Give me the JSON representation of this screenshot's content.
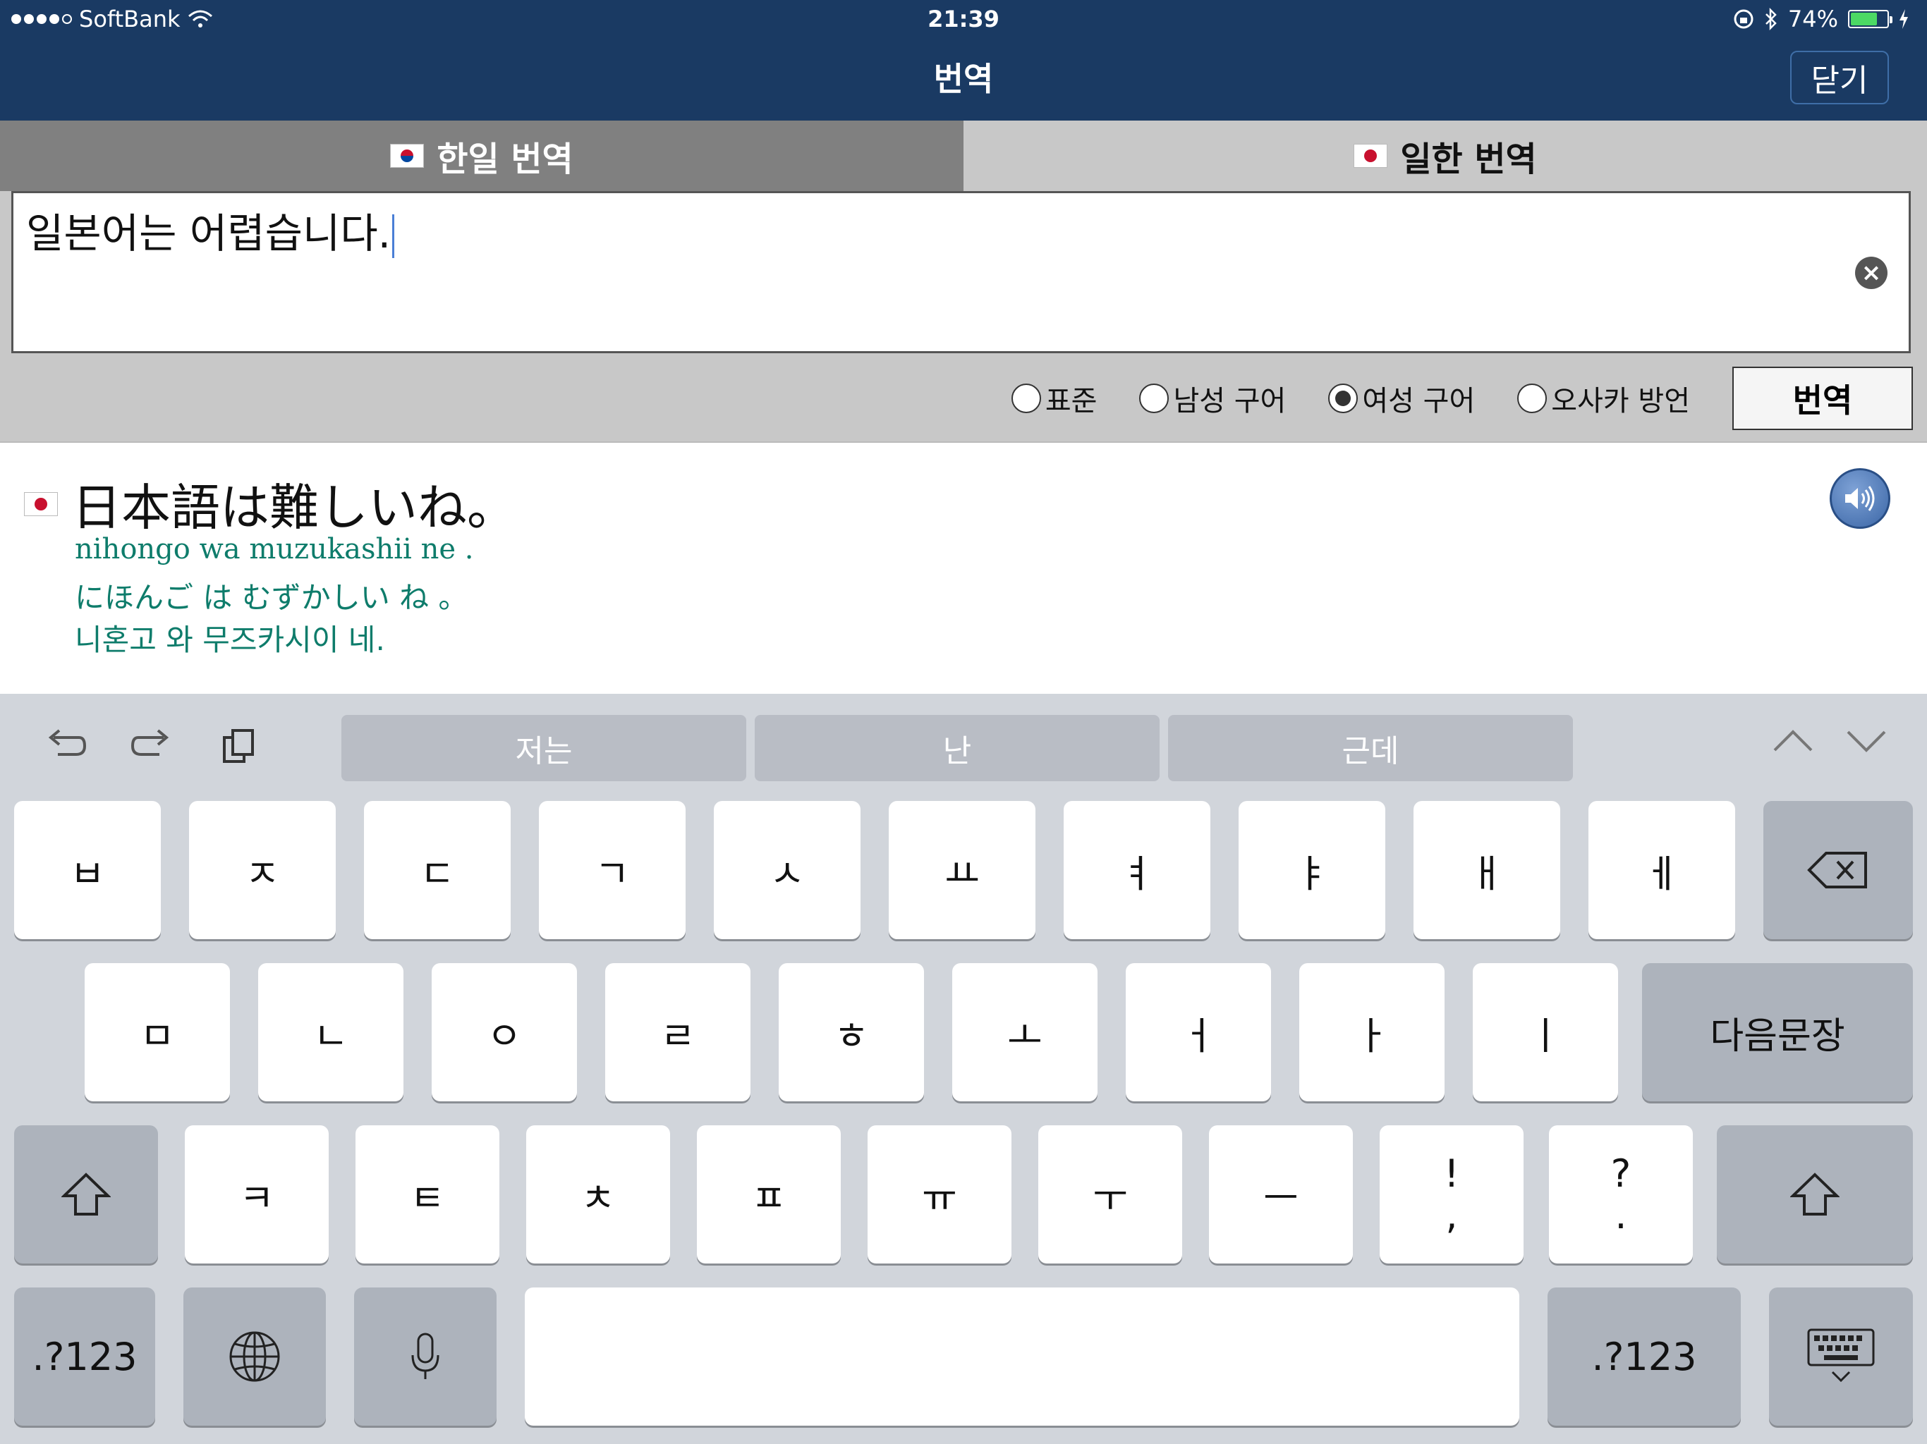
{
  "status": {
    "carrier": "SoftBank",
    "time": "21:39",
    "battery": "74%",
    "battery_level": 0.74
  },
  "nav": {
    "title": "번역",
    "close_label": "닫기"
  },
  "tabs": [
    {
      "label": "한일 번역",
      "flag": "korea-flag-icon",
      "active": true
    },
    {
      "label": "일한 번역",
      "flag": "japan-flag-icon",
      "active": false
    }
  ],
  "input": {
    "value": "일본어는 어렵습니다."
  },
  "options": [
    {
      "label": "표준",
      "selected": false
    },
    {
      "label": "남성 구어",
      "selected": false
    },
    {
      "label": "여성 구어",
      "selected": true
    },
    {
      "label": "오사카 방언",
      "selected": false
    }
  ],
  "translate_label": "번역",
  "result": {
    "japanese": "日本語は難しいね。",
    "romaji": "nihongo wa muzukashii ne .",
    "kana": "にほんご は むずかしい ね 。",
    "hangul": "니혼고 와 무즈카시이 네."
  },
  "keyboard": {
    "suggestions": [
      "저는",
      "난",
      "근데"
    ],
    "row1": [
      "ㅂ",
      "ㅈ",
      "ㄷ",
      "ㄱ",
      "ㅅ",
      "ㅛ",
      "ㅕ",
      "ㅑ",
      "ㅐ",
      "ㅔ"
    ],
    "row2": [
      "ㅁ",
      "ㄴ",
      "ㅇ",
      "ㄹ",
      "ㅎ",
      "ㅗ",
      "ㅓ",
      "ㅏ",
      "ㅣ"
    ],
    "next_sentence": "다음문장",
    "row3": [
      "ㅋ",
      "ㅌ",
      "ㅊ",
      "ㅍ",
      "ㅠ",
      "ㅜ",
      "ㅡ"
    ],
    "punct1": {
      "top": "!",
      "bottom": ","
    },
    "punct2": {
      "top": "?",
      "bottom": "."
    },
    "numbers_label": ".?123"
  },
  "colors": {
    "nav_bg": "#1a3a63",
    "tab_active": "#808080",
    "tab_inactive": "#c8c8c8",
    "romanization": "#0e7c6b",
    "keyboard_bg": "#d1d5db"
  }
}
